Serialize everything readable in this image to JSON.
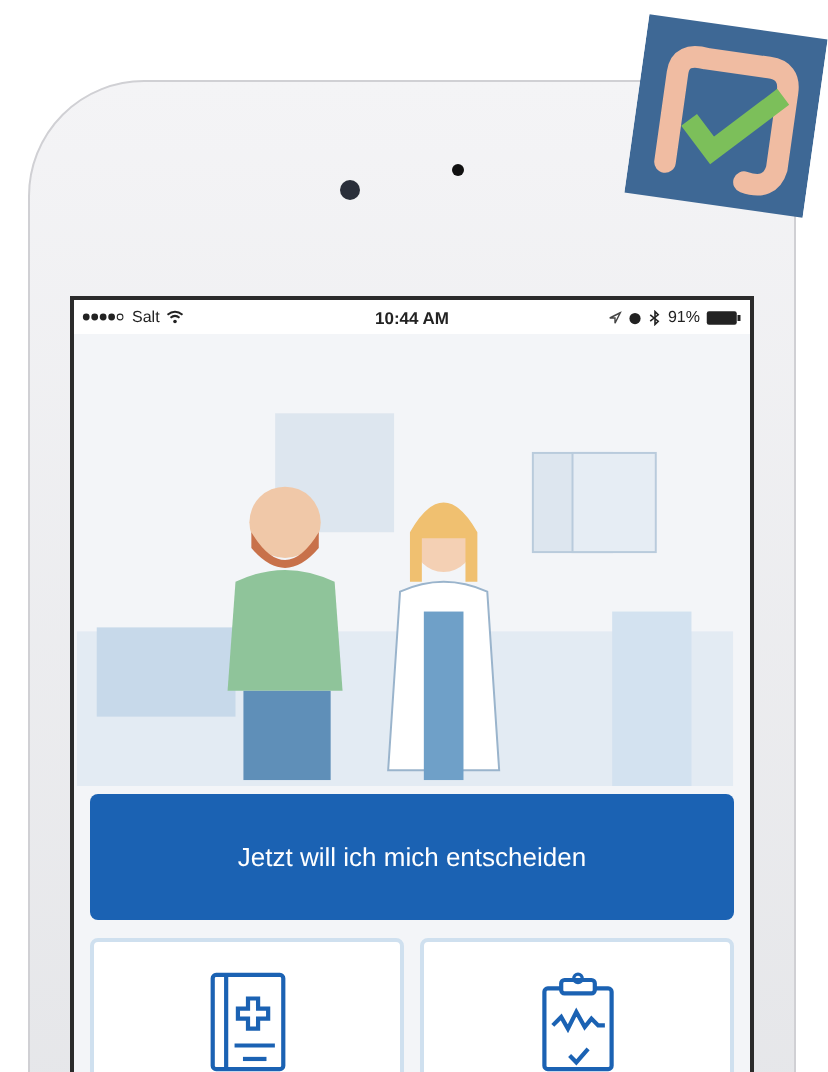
{
  "status_bar": {
    "carrier": "Salt",
    "time": "10:44 AM",
    "battery": "91%"
  },
  "primary_button": {
    "label": "Jetzt will ich mich entscheiden"
  },
  "cards": [
    {
      "kind": "book"
    },
    {
      "kind": "clipboard"
    }
  ]
}
